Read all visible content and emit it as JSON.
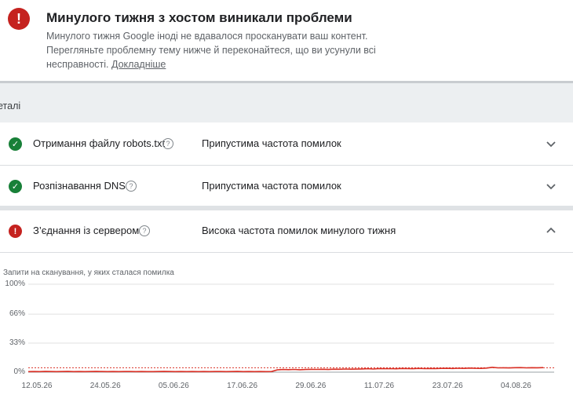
{
  "banner": {
    "title": "Минулого тижня з хостом виникали проблеми",
    "body": "Минулого тижня Google іноді не вдавалося просканувати ваш контент. Перегляньте проблемну тему нижче й переконайтеся, що ви усунули всі несправності.",
    "link": "Докладніше",
    "icon": "error-icon"
  },
  "details": {
    "label": "еталі"
  },
  "rows": [
    {
      "name": "Отримання файлу robots.txt",
      "rate": "Припустима частота помилок",
      "status": "ok",
      "expanded": false
    },
    {
      "name": "Розпізнавання DNS",
      "rate": "Припустима частота помилок",
      "status": "ok",
      "expanded": false
    },
    {
      "name": "З’єднання із сервером",
      "rate": "Висока частота помилок минулого тижня",
      "status": "error",
      "expanded": true
    }
  ],
  "colors": {
    "error": "#c5221f",
    "ok": "#188038",
    "line": "#d93025"
  },
  "chart_data": {
    "type": "line",
    "title": "Запити на сканування, у яких сталася помилка",
    "y_ticks": [
      "100%",
      "66%",
      "33%",
      "0%"
    ],
    "ylim": [
      0,
      100
    ],
    "x_ticks": [
      "12.05.26",
      "24.05.26",
      "05.06.26",
      "17.06.26",
      "29.06.26",
      "11.07.26",
      "23.07.26",
      "04.08.26"
    ],
    "threshold_percent": 5,
    "series": [
      {
        "values": [
          0.6,
          0.7,
          0.6,
          0.8,
          0.7,
          0.6,
          0.7,
          0.8,
          0.6,
          0.7,
          0.6,
          0.7,
          0.8,
          0.7,
          0.6,
          0.7,
          0.6,
          0.7,
          0.7,
          0.6,
          0.7,
          0.6,
          0.6,
          0.7,
          0.8,
          0.7,
          0.6,
          0.7,
          0.6,
          0.7,
          0.6,
          0.7,
          0.6,
          0.7,
          0.7,
          0.6,
          0.7,
          0.8,
          0.6,
          0.7,
          0.6,
          0.7,
          0.6,
          0.7,
          2.6,
          3.0,
          2.9,
          3.1,
          2.8,
          3.0,
          3.2,
          3.1,
          3.3,
          3.0,
          3.4,
          3.3,
          3.6,
          3.4,
          3.5,
          3.7,
          3.9,
          3.6,
          4.1,
          3.9,
          4.0,
          3.8,
          4.2,
          4.1,
          3.9,
          4.3,
          4.0,
          4.2,
          4.1,
          4.3,
          4.4,
          4.2,
          4.5,
          4.3,
          4.6,
          4.4,
          4.3,
          4.6,
          5.5,
          4.9,
          5.0,
          4.8,
          5.1,
          5.2,
          4.9,
          5.1,
          5.0,
          5.2
        ]
      }
    ]
  }
}
